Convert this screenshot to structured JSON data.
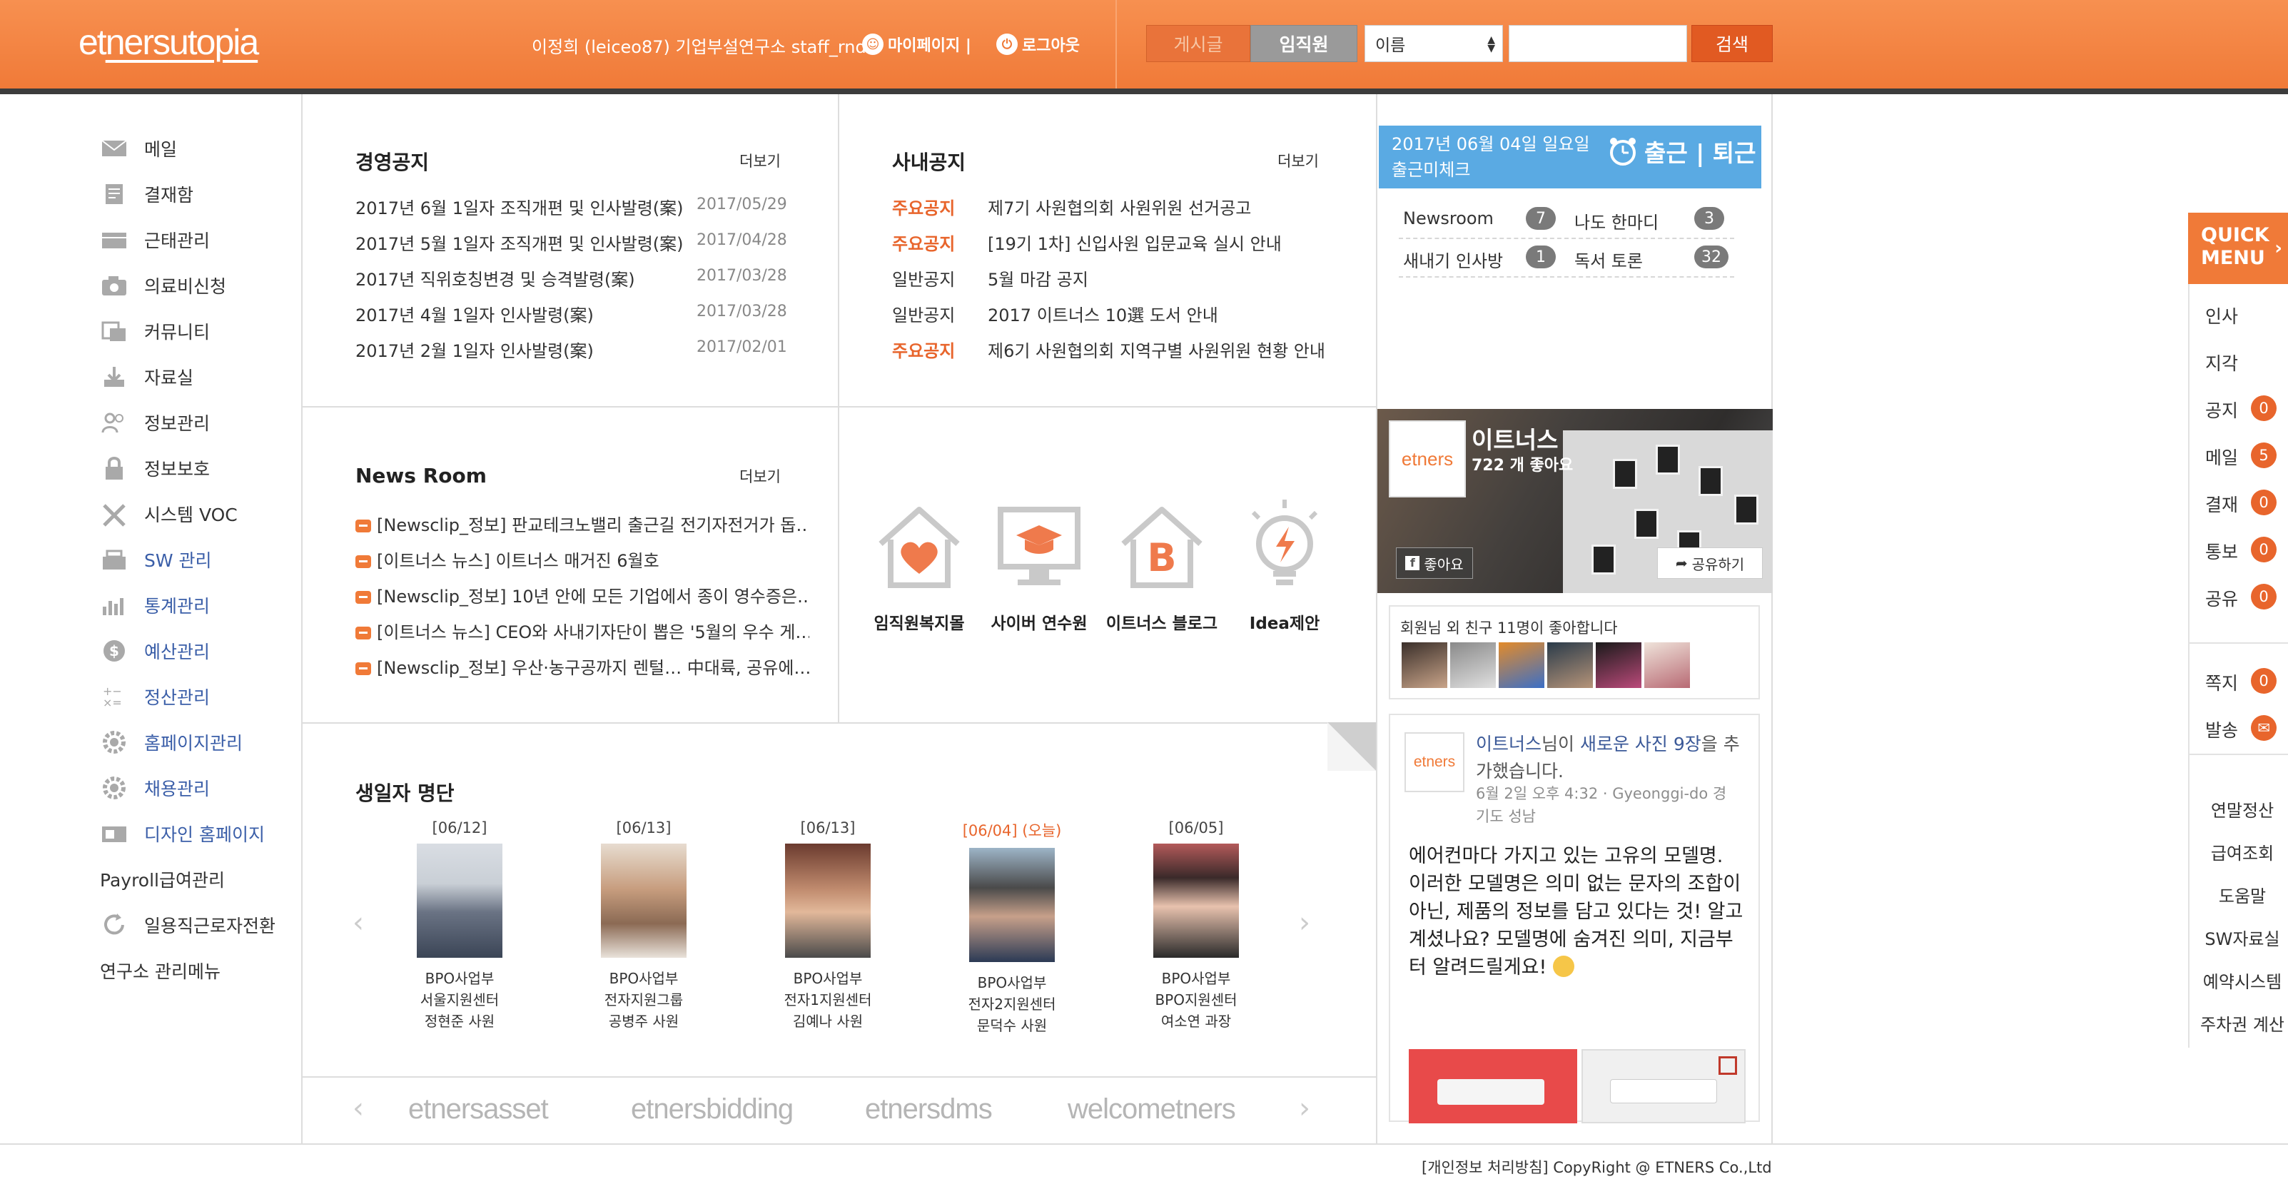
{
  "header": {
    "logo_parts": [
      "et",
      "ners",
      "utopia"
    ],
    "user_info": "이정희 (leiceo87) 기업부설연구소 staff_rnd",
    "mypage": "마이페이지 |",
    "logout": "로그아웃",
    "tab_post": "게시글",
    "tab_staff": "임직원",
    "select_value": "이름",
    "search_button": "검색",
    "search_value": ""
  },
  "nav": {
    "items": [
      {
        "label": "메일",
        "icon": "envelope-icon"
      },
      {
        "label": "결재함",
        "icon": "document-icon"
      },
      {
        "label": "근태관리",
        "icon": "folder-icon"
      },
      {
        "label": "의료비신청",
        "icon": "camera-icon"
      },
      {
        "label": "커뮤니티",
        "icon": "community-icon"
      },
      {
        "label": "자료실",
        "icon": "download-icon"
      },
      {
        "label": "정보관리",
        "icon": "people-icon"
      },
      {
        "label": "정보보호",
        "icon": "lock-icon"
      },
      {
        "label": "시스템 VOC",
        "icon": "tools-icon"
      },
      {
        "label": "SW 관리",
        "icon": "sw-icon"
      },
      {
        "label": "통계관리",
        "icon": "bar-chart-icon"
      },
      {
        "label": "예산관리",
        "icon": "dollar-icon"
      },
      {
        "label": "정산관리",
        "icon": "calculator-icon"
      },
      {
        "label": "홈페이지관리",
        "icon": "gear-icon"
      },
      {
        "label": "채용관리",
        "icon": "gear-icon"
      },
      {
        "label": "디자인 홈페이지",
        "icon": "design-icon"
      },
      {
        "label": "Payroll급여관리",
        "icon": ""
      },
      {
        "label": "일용직근로자전환",
        "icon": "refresh-icon"
      },
      {
        "label": "연구소 관리메뉴",
        "icon": ""
      }
    ]
  },
  "mgmt_notice": {
    "title": "경영공지",
    "more": "더보기",
    "items": [
      {
        "text": "2017년 6월 1일자 조직개편 및 인사발령(案)",
        "date": "2017/05/29"
      },
      {
        "text": "2017년 5월 1일자 조직개편 및 인사발령(案)",
        "date": "2017/04/28"
      },
      {
        "text": "2017년 직위호칭변경 및 승격발령(案)",
        "date": "2017/03/28"
      },
      {
        "text": "2017년 4월 1일자 인사발령(案)",
        "date": "2017/03/28"
      },
      {
        "text": "2017년 2월 1일자 인사발령(案)",
        "date": "2017/02/01"
      }
    ]
  },
  "company_notice": {
    "title": "사내공지",
    "more": "더보기",
    "items": [
      {
        "tag": "주요공지",
        "tag_type": "main",
        "text": "제7기 사원협의회 사원위원 선거공고"
      },
      {
        "tag": "주요공지",
        "tag_type": "main",
        "text": "[19기 1차] 신입사원 입문교육 실시 안내"
      },
      {
        "tag": "일반공지",
        "tag_type": "normal",
        "text": "5월 마감 공지"
      },
      {
        "tag": "일반공지",
        "tag_type": "normal",
        "text": "2017 이트너스 10選 도서 안내"
      },
      {
        "tag": "주요공지",
        "tag_type": "main",
        "text": "제6기 사원협의회 지역구별 사원위원 현황 안내"
      }
    ]
  },
  "news_room": {
    "title": "News Room",
    "more": "더보기",
    "items": [
      "[Newsclip_정보] 판교테크노밸리 출근길 전기자전거가 돕…",
      "[이트너스 뉴스] 이트너스 매거진 6월호",
      "[Newsclip_정보] 10년 안에 모든 기업에서 종이 영수증은…",
      "[이트너스 뉴스] CEO와 사내기자단이 뽑은 '5월의 우수 게…",
      "[Newsclip_정보] 우산·농구공까지 렌털… 中대륙, 공유에…"
    ]
  },
  "quick_links": [
    {
      "label": "임직원복지몰",
      "icon": "house-heart-icon"
    },
    {
      "label": "사이버 연수원",
      "icon": "monitor-graduation-icon"
    },
    {
      "label": "이트너스 블로그",
      "icon": "house-blog-icon"
    },
    {
      "label": "Idea제안",
      "icon": "lightbulb-icon"
    }
  ],
  "birthdays": {
    "title": "생일자 명단",
    "people": [
      {
        "date": "[06/12]",
        "dept": "BPO사업부",
        "team": "서울지원센터",
        "name": "정현준 사원",
        "today": false
      },
      {
        "date": "[06/13]",
        "dept": "BPO사업부",
        "team": "전자지원그룹",
        "name": "공병주 사원",
        "today": false
      },
      {
        "date": "[06/13]",
        "dept": "BPO사업부",
        "team": "전자1지원센터",
        "name": "김예나 사원",
        "today": false
      },
      {
        "date": "[06/04] (오늘)",
        "dept": "BPO사업부",
        "team": "전자2지원센터",
        "name": "문덕수 사원",
        "today": true
      },
      {
        "date": "[06/05]",
        "dept": "BPO사업부",
        "team": "BPO지원센터",
        "name": "여소연 과장",
        "today": false
      }
    ]
  },
  "system_logos": [
    "etnersasset",
    "etnersbidding",
    "etnersdms",
    "welcometners"
  ],
  "right_panel": {
    "date": "2017년 06월 04일 일요일",
    "attendance_status": "출근미체크",
    "clock_label": "출근 | 퇴근",
    "stats": [
      {
        "label": "Newsroom",
        "count": "7"
      },
      {
        "label": "나도 한마디",
        "count": "3"
      },
      {
        "label": "새내기 인사방",
        "count": "1"
      },
      {
        "label": "독서 토론",
        "count": "32"
      }
    ]
  },
  "facebook": {
    "logo_text": "etners",
    "page_name": "이트너스",
    "likes": "722 개 좋아요",
    "like_button": "좋아요",
    "share_button": "공유하기",
    "friends_text": "회원님 외 친구 11명이 좋아합니다",
    "post_author": "이트너스",
    "post_mid": "님이 ",
    "post_link": "새로운 사진 9장",
    "post_tail": "을 추가했습니다.",
    "post_meta": "6월 2일 오후 4:32 · Gyeonggi-do 경기도 성남",
    "post_body": "에어컨마다 가지고 있는 고유의 모델명. 이러한 모델명은 의미 없는 문자의 조합이 아닌, 제품의 정보를 담고 있다는 것! 알고 계셨나요? 모델명에 숨겨진 의미, 지금부터 알려드릴게요!"
  },
  "quick_menu": {
    "title_line1": "QUICK",
    "title_line2": "MENU",
    "items": [
      {
        "label": "인사",
        "badge": ""
      },
      {
        "label": "지각",
        "badge": ""
      },
      {
        "label": "공지",
        "badge": "0"
      },
      {
        "label": "메일",
        "badge": "5"
      },
      {
        "label": "결재",
        "badge": "0"
      },
      {
        "label": "통보",
        "badge": "0"
      },
      {
        "label": "공유",
        "badge": "0"
      }
    ],
    "items2": [
      {
        "label": "쪽지",
        "badge": "0"
      },
      {
        "label": "발송",
        "badge": ""
      }
    ],
    "links": [
      "연말정산",
      "급여조회",
      "도움말",
      "SW자료실",
      "예약시스템",
      "주차권 계산"
    ]
  },
  "footer": "[개인정보 처리방침] CopyRight @ ETNERS Co.,Ltd"
}
